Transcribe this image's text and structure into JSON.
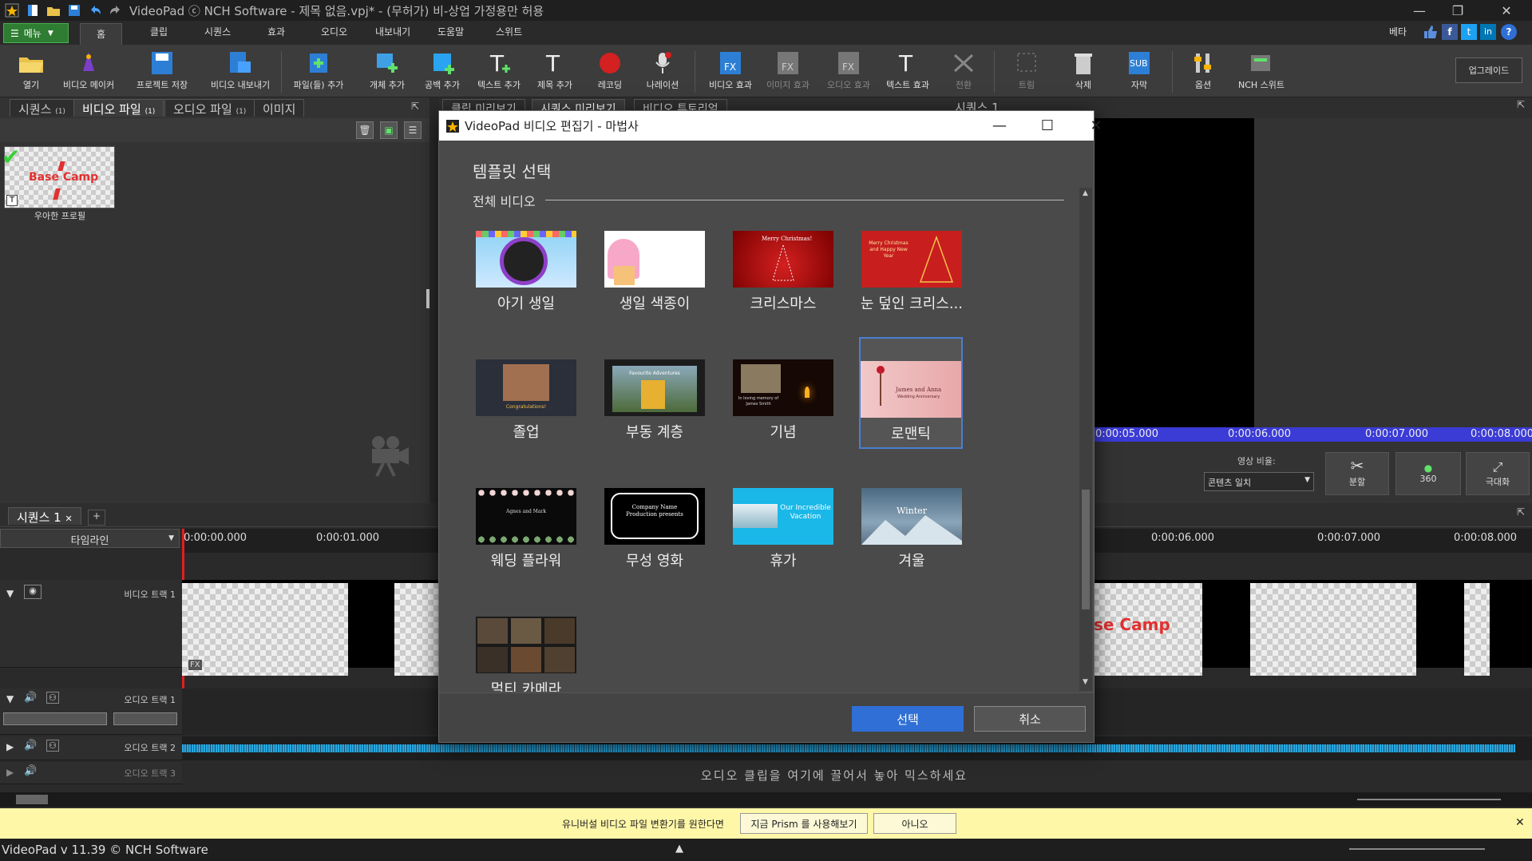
{
  "window": {
    "title": "VideoPad ⓒ NCH Software - 제목 없음.vpj* - (무허가) 비-상업 가정용만 허용"
  },
  "menu_tabs": {
    "menu": "메뉴",
    "items": [
      "홈",
      "클립",
      "시퀀스",
      "효과",
      "오디오",
      "내보내기",
      "도움말",
      "스위트"
    ],
    "beta": "베타"
  },
  "toolbar": {
    "buttons": [
      "열기",
      "비디오 메이커",
      "프로젝트 저장",
      "비디오 내보내기",
      "파일(들) 추가",
      "개체 추가",
      "공백 추가",
      "텍스트 추가",
      "제목 추가",
      "레코딩",
      "나레이션",
      "비디오 효과",
      "이미지 효과",
      "오디오 효과",
      "텍스트 효과",
      "전환",
      "트림",
      "삭제",
      "자막",
      "옵션",
      "NCH 스위트"
    ],
    "upgrade": "업그레이드"
  },
  "left_panel": {
    "tabs": [
      "시퀀스",
      "비디오 파일",
      "오디오 파일",
      "이미지"
    ],
    "badges": [
      "(1)",
      "(1)",
      "(1)"
    ],
    "clip_label": "우아한 프로필",
    "clip_text": "Base Camp"
  },
  "preview": {
    "top_tabs": [
      "클립 미리보기",
      "시퀀스 미리보기",
      "비디오 튜토리얼"
    ],
    "sequence_label": "시퀀스 1",
    "ruler": [
      "0:00:05.000",
      "0:00:06.000",
      "0:00:07.000",
      "0:00:08.000"
    ],
    "aspect_label": "영상 비율:",
    "aspect_value": "콘텐츠 일치",
    "split": "분할",
    "btn_360": "360",
    "maximize": "극대화"
  },
  "timeline": {
    "seq_tab": "시퀀스 1",
    "mode": "타임라인",
    "ruler_left": [
      "0:00:00.000",
      "0:00:01.000"
    ],
    "ruler_right": [
      "0:00:06.000",
      "0:00:07.000",
      "0:00:08.000"
    ],
    "video_track": "비디오 트랙 1",
    "audio_track1": "오디오 트랙 1",
    "audio_track2": "오디오 트랙 2",
    "audio_track3": "오디오 트랙 3",
    "clip_text": "se Camp",
    "drop_hint": "오디오 클립을 여기에 끌어서 놓아 믹스하세요"
  },
  "dialog": {
    "title": "VideoPad 비디오 편집기 - 마법사",
    "heading": "템플릿 선택",
    "section": "전체 비디오",
    "templates": [
      {
        "label": "아기 생일"
      },
      {
        "label": "생일 색종이"
      },
      {
        "label": "크리스마스",
        "img_text": "Merry Christmas!"
      },
      {
        "label": "눈 덮인 크리스...",
        "img_text": "Merry Christmas and Happy New Year"
      },
      {
        "label": "졸업",
        "img_text": "Congratulations!"
      },
      {
        "label": "부동 계층",
        "img_text": "Favourite Adventures"
      },
      {
        "label": "기념",
        "img_text": "In loving memory of James Smith"
      },
      {
        "label": "로맨틱",
        "img_text": "James and Anna",
        "img_text2": "Wedding Anniversary"
      },
      {
        "label": "웨딩 플라워",
        "img_text": "Agnes and Mark"
      },
      {
        "label": "무성 영화",
        "img_text": "Company Name Production presents"
      },
      {
        "label": "휴가",
        "img_text": "Our Incredible Vacation"
      },
      {
        "label": "겨울",
        "img_text": "Winter"
      },
      {
        "label": "멀티 카메라"
      }
    ],
    "select": "선택",
    "cancel": "취소"
  },
  "notification": {
    "text": "유니버설 비디오 파일 변환기를 원한다면",
    "try_btn": "지금 Prism 를 사용해보기",
    "no_btn": "아니오"
  },
  "status": {
    "version": "VideoPad v 11.39 © NCH Software"
  },
  "colors": {
    "accent": "#2f6fd6",
    "menu_green": "#2e7d32",
    "ruler_blue": "#3b3bd6",
    "waveform": "#29a8e0"
  }
}
